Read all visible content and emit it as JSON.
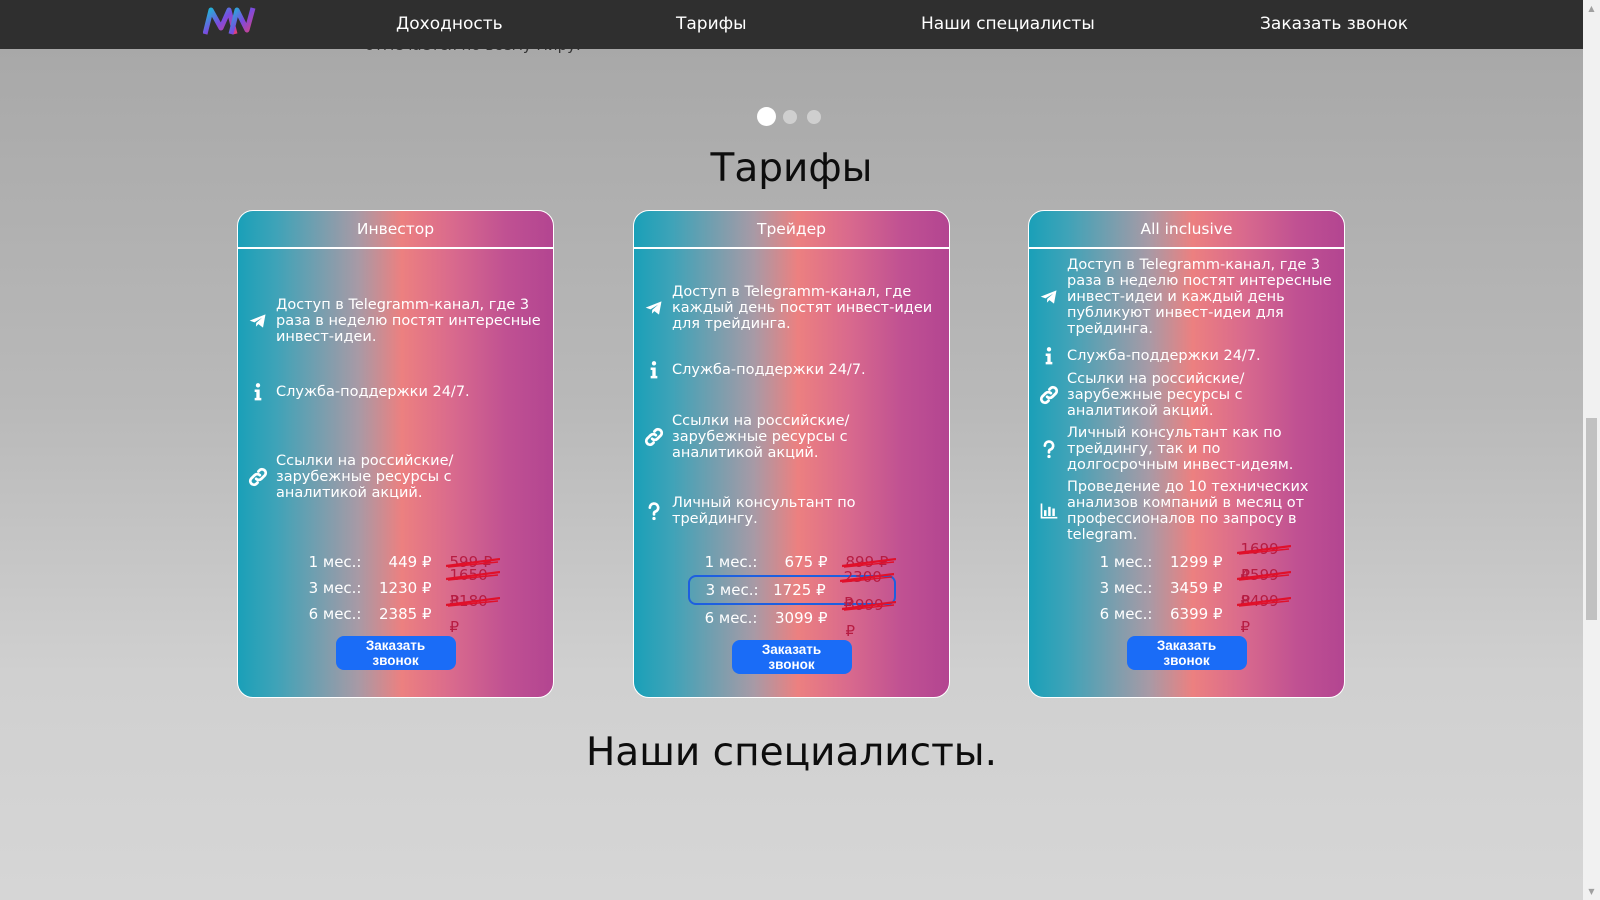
{
  "nav": {
    "logo_text": "MN",
    "links": [
      "Доходность",
      "Тарифы",
      "Наши специалисты",
      "Заказать звонок"
    ],
    "underlying_text": "отмечается по всему миру."
  },
  "slider": {
    "dots_count": 3,
    "active_index": 0
  },
  "tariffs_title": "Тарифы",
  "specialists_title": "Наши специалисты.",
  "cards": [
    {
      "title": "Инвестор",
      "features": [
        {
          "icon": "telegram-icon",
          "text": "Доступ в Telegramm-канал, где 3 раза в неделю постят интересные инвест-идеи."
        },
        {
          "icon": "info-icon",
          "text": "Служба-поддержки 24/7."
        },
        {
          "icon": "link-icon",
          "text": "Ссылки на российские/ зарубежные ресурсы с аналитикой акций."
        }
      ],
      "prices": [
        {
          "period": "1 мес.:",
          "price": "449 ₽",
          "old": "599 ₽",
          "highlight": false
        },
        {
          "period": "3 мес.:",
          "price": "1230 ₽",
          "old": "1650 ₽",
          "highlight": false
        },
        {
          "period": "6 мес.:",
          "price": "2385 ₽",
          "old": "3180 ₽",
          "highlight": false
        }
      ],
      "button": "Заказать звонок"
    },
    {
      "title": "Трейдер",
      "features": [
        {
          "icon": "telegram-icon",
          "text": "Доступ в Telegramm-канал, где каждый день постят инвест-идеи для трейдинга."
        },
        {
          "icon": "info-icon",
          "text": "Служба-поддержки 24/7."
        },
        {
          "icon": "link-icon",
          "text": "Ссылки на российские/ зарубежные ресурсы с аналитикой акций."
        },
        {
          "icon": "question-icon",
          "text": "Личный консультант по трейдингу."
        }
      ],
      "prices": [
        {
          "period": "1 мес.:",
          "price": "675 ₽",
          "old": "899 ₽",
          "highlight": false
        },
        {
          "period": "3 мес.:",
          "price": "1725 ₽",
          "old": "2300 ₽",
          "highlight": true
        },
        {
          "period": "6 мес.:",
          "price": "3099 ₽",
          "old": "3999 ₽",
          "highlight": false
        }
      ],
      "button": "Заказать звонок"
    },
    {
      "title": "All inclusive",
      "features": [
        {
          "icon": "telegram-icon",
          "text": "Доступ в Telegramm-канал, где 3 раза в неделю постят интересные инвест-идеи и каждый день публикуют инвест-идеи для трейдинга."
        },
        {
          "icon": "info-icon",
          "text": "Служба-поддержки 24/7."
        },
        {
          "icon": "link-icon",
          "text": "Ссылки на российские/ зарубежные ресурсы с аналитикой акций."
        },
        {
          "icon": "question-icon",
          "text": "Личный консультант как по трейдингу, так и по долгосрочным инвест-идеям."
        },
        {
          "icon": "chart-icon",
          "text": "Проведение до 10 технических анализов компаний в месяц от профессионалов по запросу в telegram."
        }
      ],
      "prices": [
        {
          "period": "1 мес.:",
          "price": "1299 ₽",
          "old": "1699 ₽",
          "highlight": false
        },
        {
          "period": "3 мес.:",
          "price": "3459 ₽",
          "old": "4599 ₽",
          "highlight": false
        },
        {
          "period": "6 мес.:",
          "price": "6399 ₽",
          "old": "8499 ₽",
          "highlight": false
        }
      ],
      "button": "Заказать звонок"
    }
  ],
  "colors": {
    "nav_bg": "#2f2f2f",
    "card_gradient_start": "#1aa0b8",
    "card_gradient_mid": "#ec8080",
    "card_gradient_end": "#b34591",
    "button_bg": "#1a6cf7",
    "strike_color": "#e0102a",
    "highlight_border": "#1d5fe0"
  }
}
